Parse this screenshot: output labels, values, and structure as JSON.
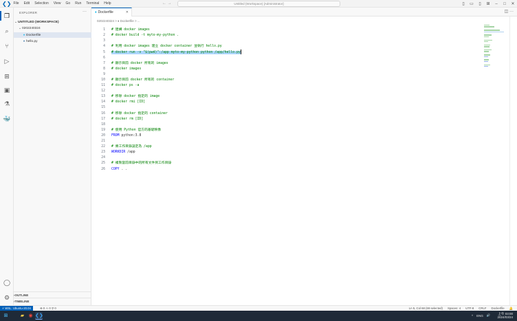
{
  "titlebar": {
    "menu": [
      "File",
      "Edit",
      "Selection",
      "View",
      "Go",
      "Run",
      "Terminal",
      "Help"
    ],
    "search_text": "Untitled (Workspace) [Administrator]",
    "nav_arrows": "← →"
  },
  "sidebar": {
    "title": "EXPLORER",
    "more": "···",
    "workspace": "UNTITLED (WORKSPACE)",
    "folder": "0202240324",
    "files": [
      {
        "name": "Dockerfile",
        "icon": "docker-icon",
        "selected": true
      },
      {
        "name": "hello.py",
        "icon": "python-icon",
        "selected": false
      }
    ],
    "outline": "OUTLINE",
    "timeline": "TIMELINE"
  },
  "editor": {
    "tab_label": "Dockerfile",
    "breadcrumb": "0202240324 > ♦ Dockerfile > ...",
    "lines": [
      {
        "n": "1",
        "kind": "comment",
        "text": "# 建構 docker images"
      },
      {
        "n": "2",
        "kind": "comment",
        "text": "# docker build -t myto-my-python ."
      },
      {
        "n": "3",
        "kind": "blank",
        "text": ""
      },
      {
        "n": "4",
        "kind": "comment",
        "text": "# 利用 docker images 建立 docker container 並執行 hello.py"
      },
      {
        "n": "5",
        "kind": "selected",
        "text": "# docker run -v \"$(pwd)\":/app myto-my-python python /app/hello.py"
      },
      {
        "n": "6",
        "kind": "blank",
        "text": ""
      },
      {
        "n": "7",
        "kind": "comment",
        "text": "# 顯示目前 docker 所有的 images"
      },
      {
        "n": "8",
        "kind": "comment",
        "text": "# docker images"
      },
      {
        "n": "9",
        "kind": "blank",
        "text": ""
      },
      {
        "n": "10",
        "kind": "comment",
        "text": "# 顯示目前 docker 所有的 container"
      },
      {
        "n": "11",
        "kind": "comment",
        "text": "# docker ps -a"
      },
      {
        "n": "12",
        "kind": "blank",
        "text": ""
      },
      {
        "n": "13",
        "kind": "comment",
        "text": "# 移除 docker 指定的 image"
      },
      {
        "n": "14",
        "kind": "comment",
        "text": "# docker rmi [ID]"
      },
      {
        "n": "15",
        "kind": "blank",
        "text": ""
      },
      {
        "n": "16",
        "kind": "comment",
        "text": "# 移除 docker 指定的 container"
      },
      {
        "n": "17",
        "kind": "comment",
        "text": "# docker rm [ID]"
      },
      {
        "n": "18",
        "kind": "blank",
        "text": ""
      },
      {
        "n": "19",
        "kind": "comment",
        "text": "# 使用 Python 官方的基礎映像"
      },
      {
        "n": "20",
        "kind": "code",
        "kw": "FROM",
        "text": " python:3.8"
      },
      {
        "n": "21",
        "kind": "blank",
        "text": ""
      },
      {
        "n": "22",
        "kind": "comment",
        "text": "# 將工作目錄設定為 /app"
      },
      {
        "n": "23",
        "kind": "code",
        "kw": "WORKDIR",
        "text": " /app"
      },
      {
        "n": "24",
        "kind": "blank",
        "text": ""
      },
      {
        "n": "25",
        "kind": "comment",
        "text": "# 複製當前目錄中的所有文件到工作目錄"
      },
      {
        "n": "26",
        "kind": "code",
        "kw": "COPY",
        "text": " . ."
      }
    ]
  },
  "statusbar": {
    "remote": "⚡ WSL: Ubuntu-20.04",
    "problems": "⊗ 0 ⚠ 0  ⚲ 0",
    "items": [
      "Ln 5, Col 68 (69 selected)",
      "Spaces: 4",
      "UTF-8",
      "CRLF",
      "Dockerfile",
      "🔔"
    ]
  },
  "taskbar": {
    "tray": [
      "^",
      "ENG",
      "🔊"
    ],
    "time": "上午 03:00",
    "date": "2024/03/24"
  },
  "colors": {
    "accent": "#005fb8",
    "comment": "#008000",
    "keyword": "#0000ff",
    "selection": "#add6ff"
  }
}
